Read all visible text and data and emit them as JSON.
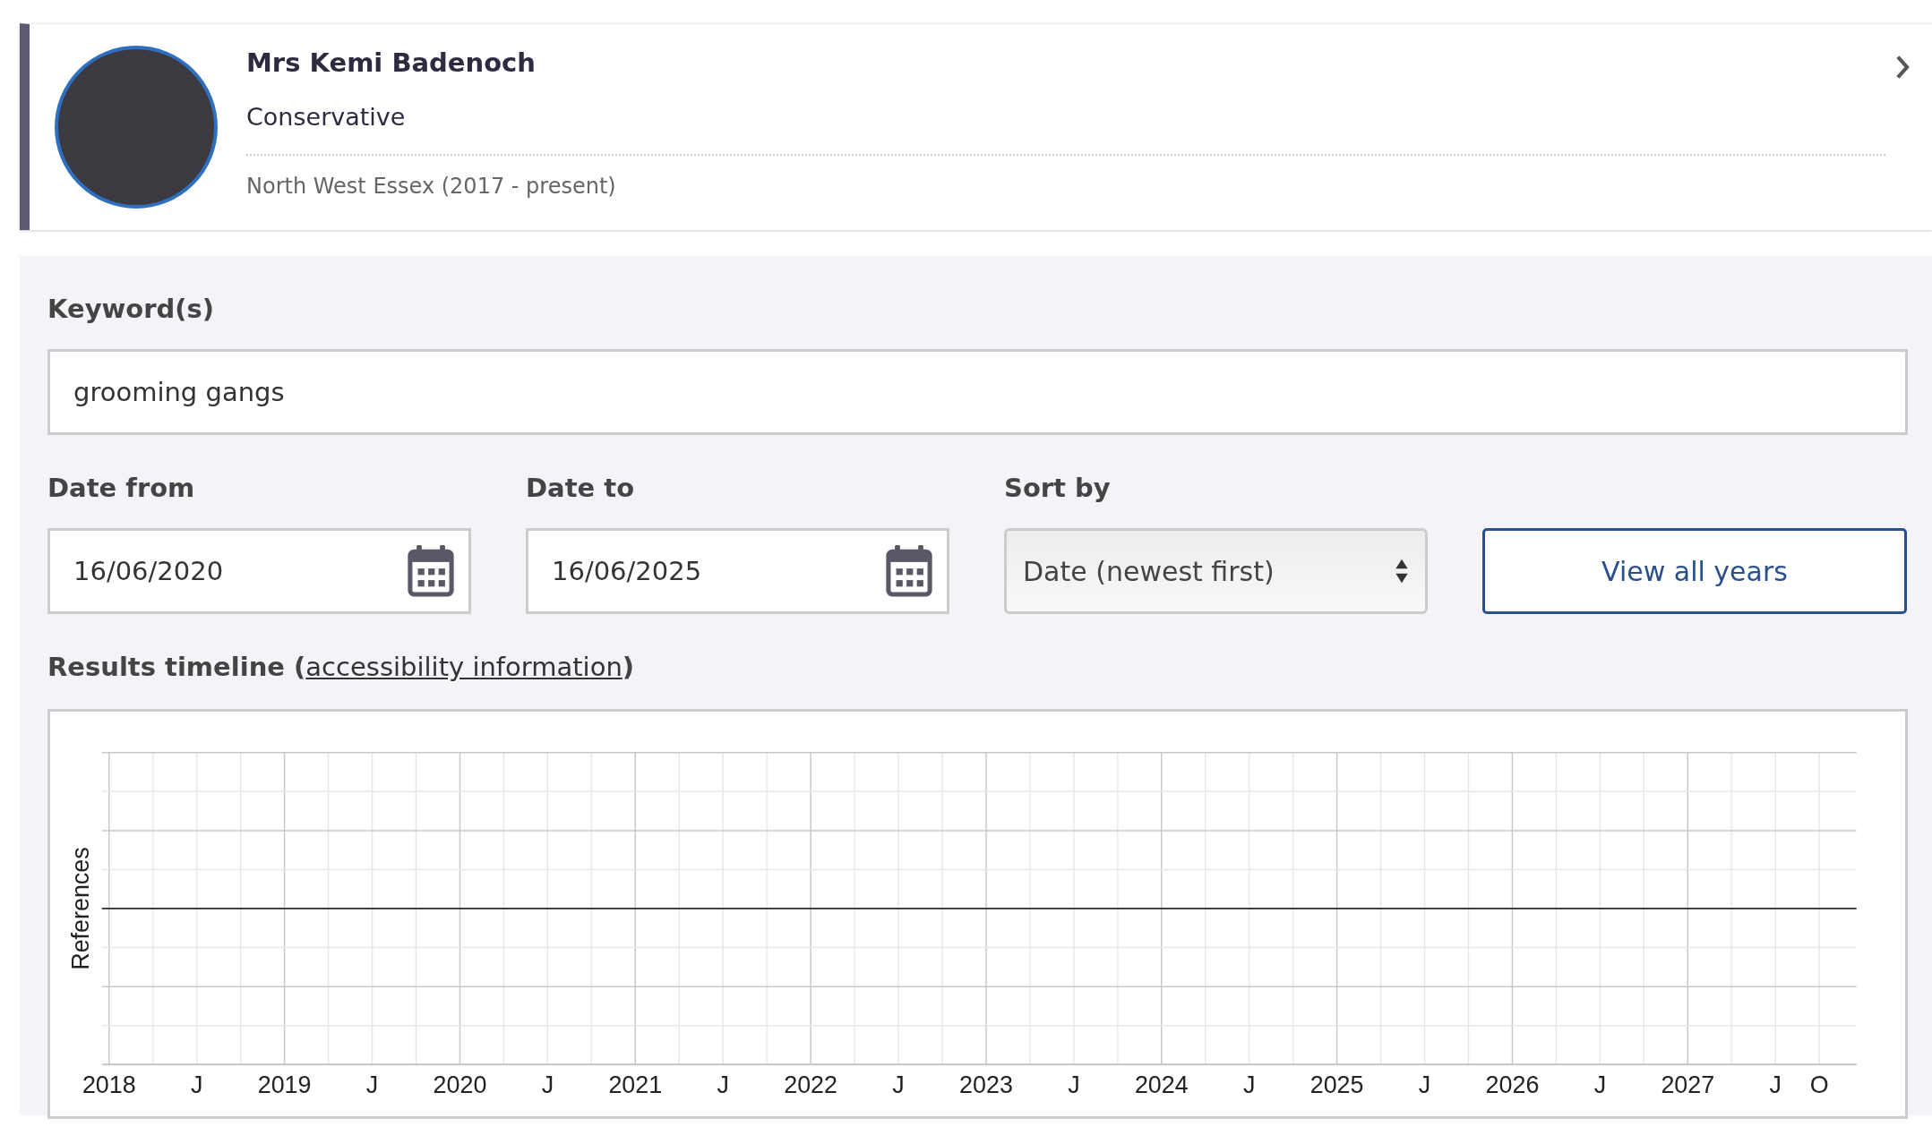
{
  "member": {
    "name": "Mrs Kemi Badenoch",
    "party": "Conservative",
    "constituency": "North West Essex (2017 - present)"
  },
  "search": {
    "keyword_label": "Keyword(s)",
    "keyword_value": "grooming gangs",
    "date_from_label": "Date from",
    "date_from_value": "16/06/2020",
    "date_to_label": "Date to",
    "date_to_value": "16/06/2025",
    "sort_label": "Sort by",
    "sort_value": "Date (newest first)",
    "view_all_button": "View all years"
  },
  "timeline": {
    "heading_before": "Results timeline (",
    "heading_link": "accessibility information",
    "heading_after": ")",
    "ylabel": "References",
    "x_ticks": [
      {
        "label": "2018",
        "kind": "year"
      },
      {
        "label": "J",
        "kind": "half"
      },
      {
        "label": "2019",
        "kind": "year"
      },
      {
        "label": "J",
        "kind": "half"
      },
      {
        "label": "2020",
        "kind": "year"
      },
      {
        "label": "J",
        "kind": "half"
      },
      {
        "label": "2021",
        "kind": "year"
      },
      {
        "label": "J",
        "kind": "half"
      },
      {
        "label": "2022",
        "kind": "year"
      },
      {
        "label": "J",
        "kind": "half"
      },
      {
        "label": "2023",
        "kind": "year"
      },
      {
        "label": "J",
        "kind": "half"
      },
      {
        "label": "2024",
        "kind": "year"
      },
      {
        "label": "J",
        "kind": "half"
      },
      {
        "label": "2025",
        "kind": "year"
      },
      {
        "label": "J",
        "kind": "half"
      },
      {
        "label": "2026",
        "kind": "year"
      },
      {
        "label": "J",
        "kind": "half"
      },
      {
        "label": "2027",
        "kind": "year"
      },
      {
        "label": "J",
        "kind": "half"
      },
      {
        "label": "O",
        "kind": "quarter"
      }
    ]
  }
}
